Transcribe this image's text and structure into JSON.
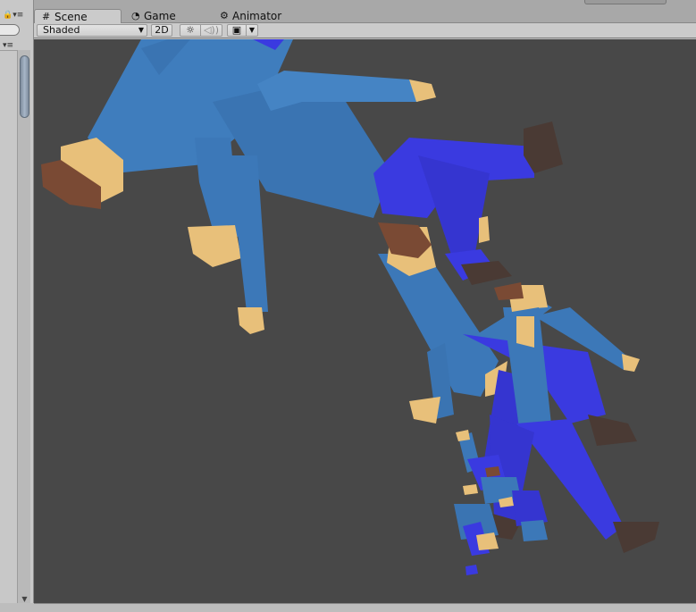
{
  "tabs": [
    {
      "label": "Scene",
      "icon": "grid-icon"
    },
    {
      "label": "Game",
      "icon": "pacman-icon"
    },
    {
      "label": "Animator",
      "icon": "animator-icon"
    }
  ],
  "toolbar": {
    "shading_mode": "Shaded",
    "btn_2d": "2D",
    "lighting_icon": "sun-icon",
    "audio_icon": "speaker-icon",
    "effects_icon": "image-icon"
  },
  "colors": {
    "viewport_bg": "#484848",
    "shirt": "#3c78b8",
    "pants": "#3a3ae0",
    "skin": "#e8c07a",
    "hair": "#7a4a34",
    "shoes": "#4a3a34"
  }
}
